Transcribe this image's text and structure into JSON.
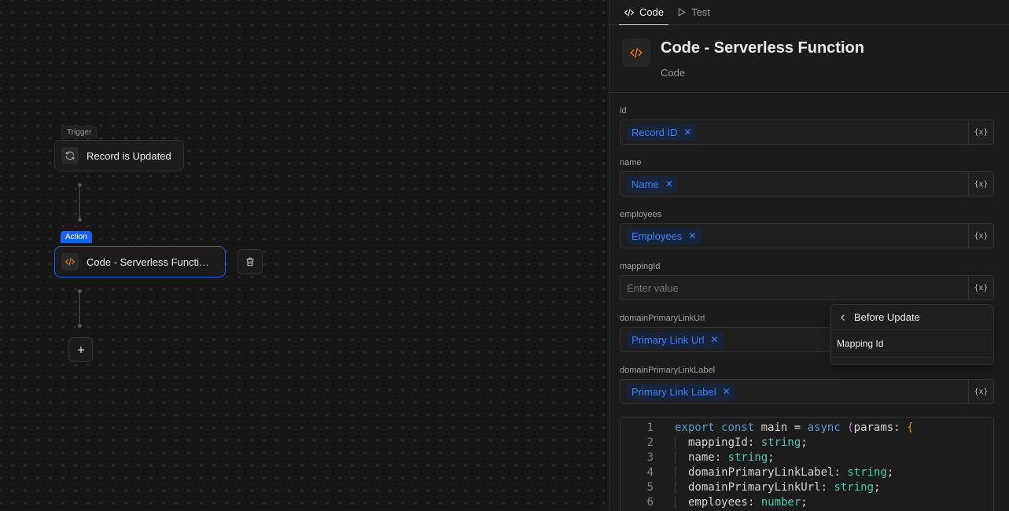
{
  "canvas": {
    "trigger_tag": "Trigger",
    "trigger_label": "Record is Updated",
    "action_tag": "Action",
    "action_label": "Code - Serverless Functi…",
    "add_label": "+"
  },
  "panel": {
    "tabs": [
      {
        "label": "Code",
        "icon": "code-icon"
      },
      {
        "label": "Test",
        "icon": "play-icon"
      }
    ],
    "title": "Code - Serverless Function",
    "subtitle": "Code",
    "fields": [
      {
        "label": "id",
        "chip": "Record ID"
      },
      {
        "label": "name",
        "chip": "Name"
      },
      {
        "label": "employees",
        "chip": "Employees"
      },
      {
        "label": "mappingId",
        "placeholder": "Enter value"
      },
      {
        "label": "domainPrimaryLinkUrl",
        "chip": "Primary Link Url"
      },
      {
        "label": "domainPrimaryLinkLabel",
        "chip": "Primary Link Label"
      }
    ],
    "variable_button": "{x}",
    "dropdown": {
      "title": "Before Update",
      "search_value": "Mapping Id"
    },
    "code_lines": [
      {
        "n": "1"
      },
      {
        "n": "2",
        "name": "mappingId",
        "type": "string"
      },
      {
        "n": "3",
        "name": "name",
        "type": "string"
      },
      {
        "n": "4",
        "name": "domainPrimaryLinkLabel",
        "type": "string"
      },
      {
        "n": "5",
        "name": "domainPrimaryLinkUrl",
        "type": "string"
      },
      {
        "n": "6",
        "name": "employees",
        "type": "number"
      }
    ],
    "code_first_line": {
      "export": "export",
      "const": "const",
      "main": " main = ",
      "async": "async",
      "paren": "(",
      "params": "params: ",
      "brace": "{"
    }
  },
  "colors": {
    "accent": "#1961ed",
    "chip_text": "#3b82f6",
    "code_icon": "#f97316"
  }
}
